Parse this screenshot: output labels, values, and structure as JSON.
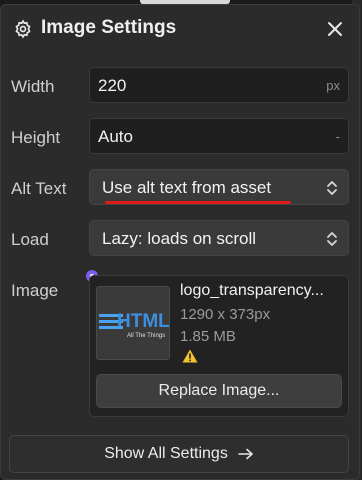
{
  "panel": {
    "title": "Image Settings",
    "icons": {
      "settings": "gear-icon",
      "close": "close-icon"
    }
  },
  "fields": {
    "width": {
      "label": "Width",
      "value": "220",
      "unit": "px"
    },
    "height": {
      "label": "Height",
      "value": "Auto",
      "unit": "-"
    },
    "alt_text": {
      "label": "Alt Text",
      "value": "Use alt text from asset"
    },
    "load": {
      "label": "Load",
      "value": "Lazy: loads on scroll"
    }
  },
  "image": {
    "label": "Image",
    "filename": "logo_transparency...",
    "dimensions": "1290 x 373px",
    "size": "1.85 MB",
    "thumbnail_text": "HTML",
    "thumbnail_subtext": "All The Things",
    "replace_label": "Replace Image..."
  },
  "footer": {
    "show_all_label": "Show All Settings",
    "arrow": "→"
  },
  "colors": {
    "accent_purple": "#7b5cf0",
    "annotation_red": "#e01b1b",
    "warning_yellow": "#f2c12e"
  }
}
